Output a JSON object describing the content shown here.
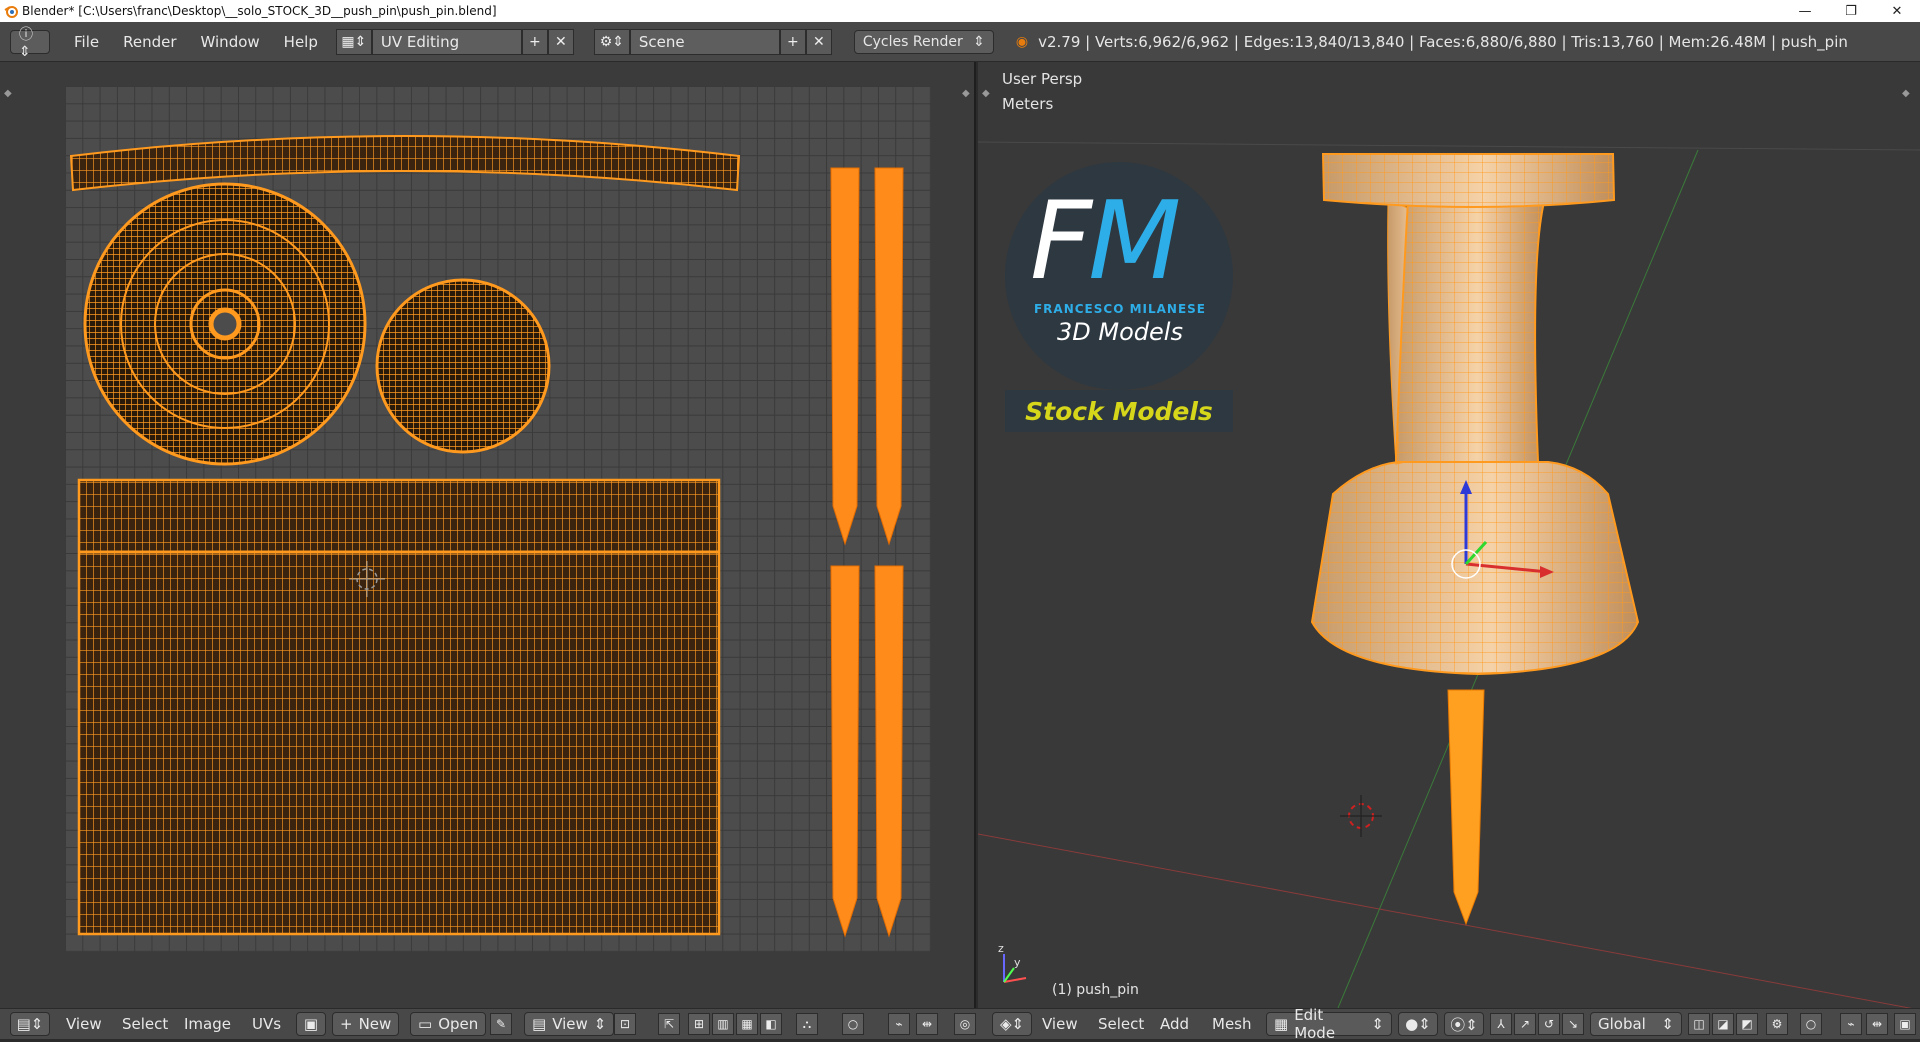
{
  "window": {
    "title": "Blender* [C:\\Users\\franc\\Desktop\\__solo_STOCK_3D__push_pin\\push_pin.blend]",
    "minimize": "—",
    "restore": "❐",
    "close": "✕"
  },
  "info_header": {
    "menus": [
      "File",
      "Render",
      "Window",
      "Help"
    ],
    "layout": "UV Editing",
    "scene": "Scene",
    "engine": "Cycles Render",
    "stats": "v2.79 | Verts:6,962/6,962 | Edges:13,840/13,840 | Faces:6,880/6,880 | Tris:13,760 | Mem:26.48M | push_pin"
  },
  "viewport": {
    "view_name": "User Persp",
    "units": "Meters",
    "object_label": "(1) push_pin"
  },
  "logo": {
    "letter_f": "F",
    "letter_m": "M",
    "name": "FRANCESCO MILANESE",
    "subtitle": "3D Models",
    "banner": "Stock Models"
  },
  "uv_bottom": {
    "view": "View",
    "select": "Select",
    "image": "Image",
    "uvs": "UVs",
    "new": "New",
    "open": "Open",
    "view2": "View"
  },
  "view3d_bottom": {
    "view": "View",
    "select": "Select",
    "add": "Add",
    "mesh": "Mesh",
    "mode": "Edit Mode",
    "orientation": "Global"
  },
  "colors": {
    "accent": "#ff8c1a",
    "uv_wire": "#ff9a1f",
    "logo_blue": "#2eaee8",
    "stock_yellow": "#d6d61a"
  }
}
